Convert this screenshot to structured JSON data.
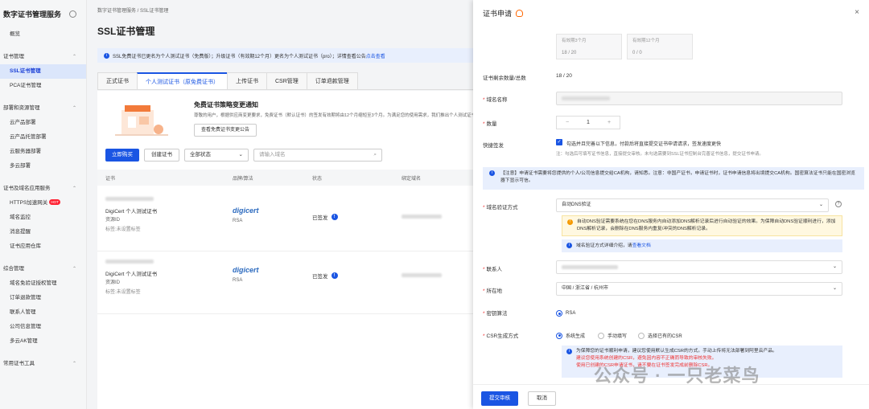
{
  "sidebar": {
    "title": "数字证书管理服务",
    "items": [
      {
        "type": "item",
        "label": "概览"
      },
      {
        "type": "sep"
      },
      {
        "type": "group",
        "label": "证书管理"
      },
      {
        "type": "item",
        "label": "SSL证书管理",
        "active": true
      },
      {
        "type": "item",
        "label": "PCA证书管理"
      },
      {
        "type": "sep"
      },
      {
        "type": "group",
        "label": "部署和资源管理"
      },
      {
        "type": "item",
        "label": "云产品部署"
      },
      {
        "type": "item",
        "label": "云产品托管部署"
      },
      {
        "type": "item",
        "label": "云服务器部署"
      },
      {
        "type": "item",
        "label": "多云部署"
      },
      {
        "type": "sep"
      },
      {
        "type": "group",
        "label": "证书及域名应用服务"
      },
      {
        "type": "item",
        "label": "HTTPS加速网关",
        "badge": "HOT"
      },
      {
        "type": "item",
        "label": "域名监控"
      },
      {
        "type": "item",
        "label": "消息提醒"
      },
      {
        "type": "item",
        "label": "证书应用仓库"
      },
      {
        "type": "sep"
      },
      {
        "type": "group",
        "label": "综合管理"
      },
      {
        "type": "item",
        "label": "域名免验证授权管理"
      },
      {
        "type": "item",
        "label": "订单退款管理"
      },
      {
        "type": "item",
        "label": "联系人管理"
      },
      {
        "type": "item",
        "label": "公司信息管理"
      },
      {
        "type": "item",
        "label": "多云AK管理"
      },
      {
        "type": "sep"
      },
      {
        "type": "group",
        "label": "常用证书工具"
      }
    ]
  },
  "main": {
    "breadcrumb": "数字证书管理服务  /  SSL证书管理",
    "title": "SSL证书管理",
    "notice": {
      "text": "SSL免费证书已更名为个人测试证书（免费版）；升级证书（有效期12个月）更名为个人测试证书（pro）；详情查看公告",
      "link": "点击查看"
    },
    "tabs": [
      "正式证书",
      "个人测试证书（原免费证书）",
      "上传证书",
      "CSR管理",
      "订单退款管理"
    ],
    "promo": {
      "title": "免费证书策略变更通知",
      "text": "尊敬的用户，根据供应商变更要求，免费证书（默认证书）的签发有效期将由12个月缩短至3个月。为满足您的使用需求，我们推出个人测试证书（pro），升级",
      "button": "查看免费证书变更公告"
    },
    "toolbar": {
      "buy": "立即购买",
      "create": "创建证书",
      "status_select": "全部状态",
      "search_placeholder": "请输入域名"
    },
    "table": {
      "headers": [
        "证书",
        "品牌/算法",
        "状态",
        "绑定域名"
      ],
      "rows": [
        {
          "name": "DigiCert 个人测试证书",
          "resource": "资源ID",
          "tag": "标签:未设置标签",
          "brand": "digicert",
          "algo": "RSA",
          "status": "已签发"
        },
        {
          "name": "DigiCert 个人测试证书",
          "resource": "资源ID",
          "tag": "标签:未设置标签",
          "brand": "digicert",
          "algo": "RSA",
          "status": "已签发"
        }
      ]
    }
  },
  "drawer": {
    "title": "证书申请",
    "quota_cards": [
      {
        "label": "有效期3个月",
        "value": "18 / 20"
      },
      {
        "label": "有效期12个月",
        "value": "0 / 0"
      }
    ],
    "remaining_label": "证书剩余数量/总数",
    "remaining_value": "18 / 20",
    "domain_label": "域名名称",
    "quantity_label": "数量",
    "quantity_minus": "−",
    "quantity_value": "1",
    "quantity_plus": "+",
    "quick_label": "快捷签发",
    "quick_text": "勾选并且完善以下信息，付款后将直接提交证书申请请求，签发速度更快",
    "quick_hint": "注：勾选后可填写证书信息，直接提交审核。未勾选需要到SSL证书控制台完善证书信息，提交证书申请。",
    "attention": "【注意】申请证书需要将您提供的个人/公司信息提交给CA机构，请知悉。注意：非国产证书，申请证书时，证书申请信息将出境提交CA机构。国密算法证书只能在国密浏览器下显示可信。",
    "verify_label": "域名验证方式",
    "verify_value": "自动DNS验证",
    "verify_warn": "自动DNS验证需要系统在您在DNS服务内自动添加DNS解析记录后进行自动验证的效果。为保障自动DNS验证顺利进行，添加DNS解析记录，会删除在DNS服务内重复/冲突的DNS解析记录。",
    "verify_tip": "域名验证方式详细介绍，请",
    "verify_tip_link": "查看文档",
    "contact_label": "联系人",
    "location_label": "所在地",
    "location_value": "中国 / 浙江省 / 杭州市",
    "algo_label": "密钥算法",
    "algo_value": "RSA",
    "csr_label": "CSR生成方式",
    "csr_options": [
      "系统生成",
      "手动填写",
      "选择已有的CSR"
    ],
    "csr_note": "为保障您的证书顺利申请，建议您使用默认生成CSR的方式。手动上传将无法部署到阿里云产品。",
    "csr_note_red1": "建议您使用系统创建的CSR，避免因内容不正确而导致的审核失败。",
    "csr_note_red2": "使用已创建的CSR申请证书，请不要在证书签发完成前删除CSR。",
    "submit": "提交审核",
    "cancel": "取消"
  },
  "watermark": "公众号 · 一只老菜鸟"
}
